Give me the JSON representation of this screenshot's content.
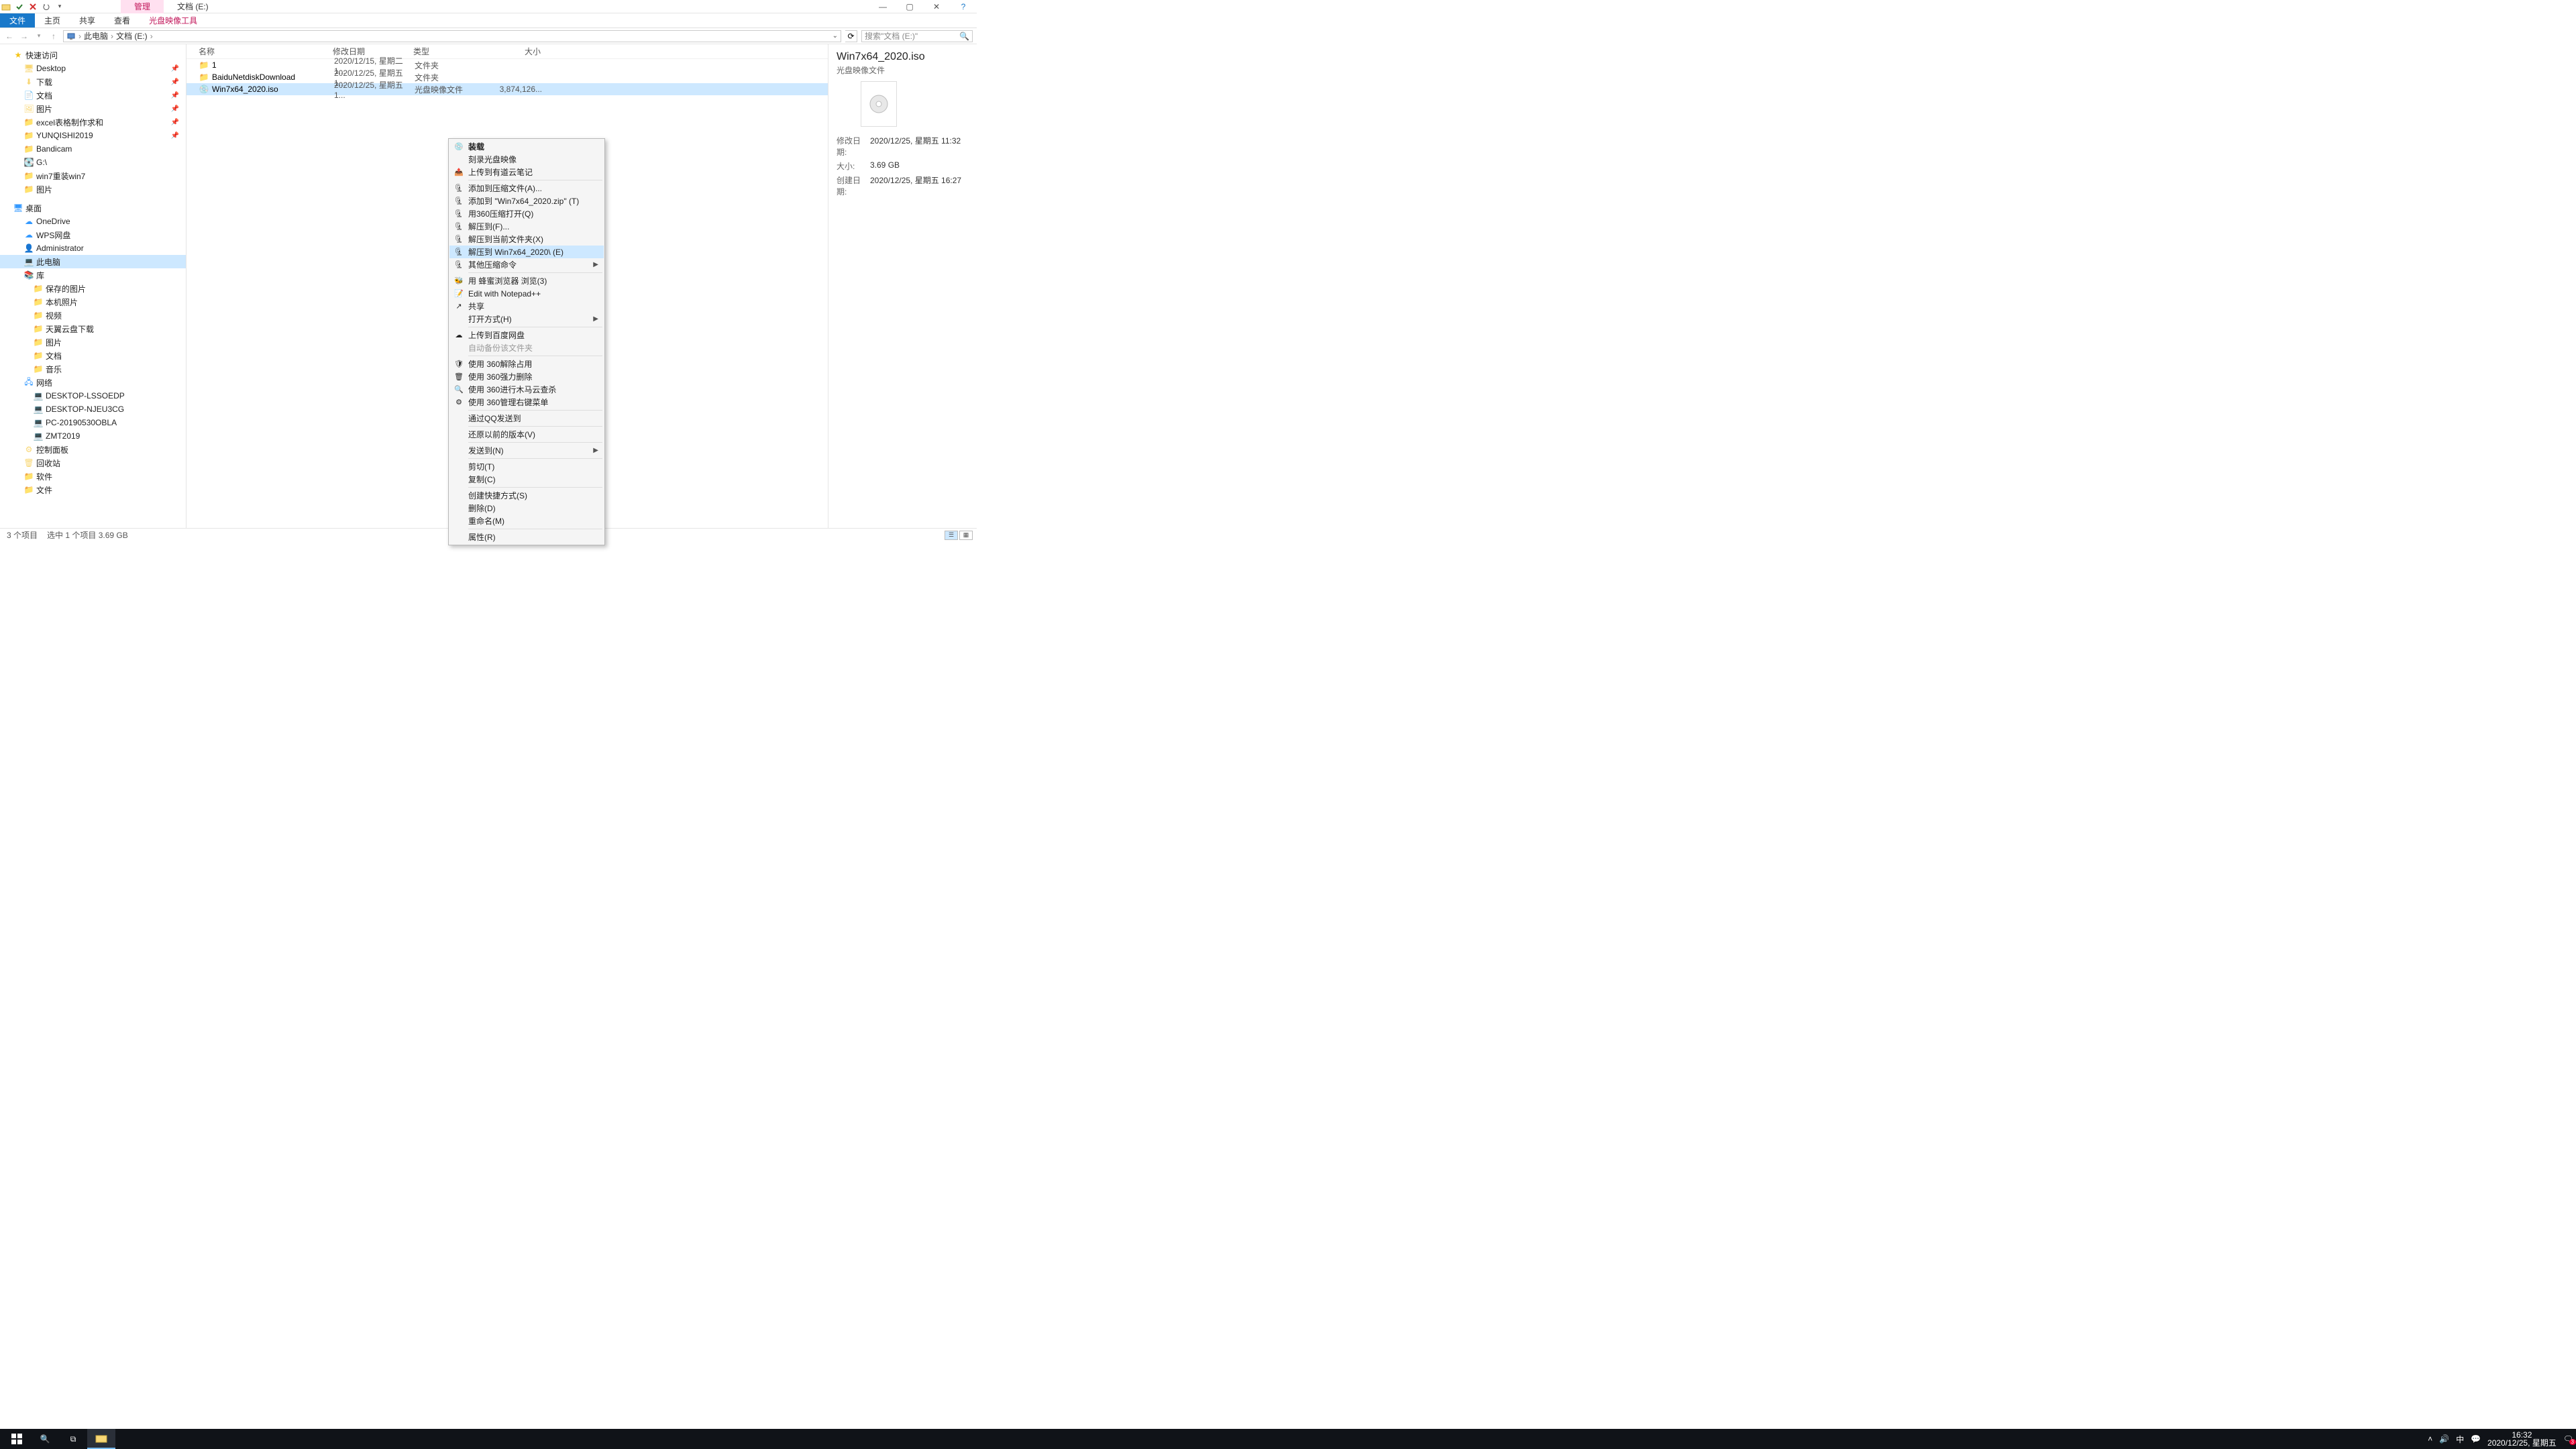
{
  "window": {
    "title_tabs": {
      "manage": "管理",
      "location": "文档 (E:)"
    },
    "sys": {
      "help": "?"
    }
  },
  "ribbon": {
    "file": "文件",
    "home": "主页",
    "share": "共享",
    "view": "查看",
    "disc_tools": "光盘映像工具"
  },
  "nav": {
    "crumbs": [
      "此电脑",
      "文档 (E:)"
    ],
    "search_ph": "搜索\"文档 (E:)\"",
    "refresh_aria": "刷新"
  },
  "tree": {
    "quick": "快速访问",
    "items1": [
      {
        "icon": "desktop",
        "label": "Desktop",
        "pin": true
      },
      {
        "icon": "download",
        "label": "下载",
        "pin": true
      },
      {
        "icon": "docs",
        "label": "文档",
        "pin": true
      },
      {
        "icon": "pics",
        "label": "图片",
        "pin": true
      },
      {
        "icon": "folder",
        "label": "excel表格制作求和",
        "pin": true
      },
      {
        "icon": "folder",
        "label": "YUNQISHI2019",
        "pin": true
      },
      {
        "icon": "folder",
        "label": "Bandicam"
      },
      {
        "icon": "drive",
        "label": "G:\\"
      },
      {
        "icon": "folder",
        "label": "win7重装win7"
      },
      {
        "icon": "folder",
        "label": "图片"
      }
    ],
    "desktop": "桌面",
    "items2": [
      {
        "icon": "onedrive",
        "label": "OneDrive"
      },
      {
        "icon": "wps",
        "label": "WPS网盘"
      },
      {
        "icon": "user",
        "label": "Administrator"
      },
      {
        "icon": "pc",
        "label": "此电脑",
        "sel": true
      },
      {
        "icon": "lib",
        "label": "库"
      }
    ],
    "items3": [
      {
        "label": "保存的图片"
      },
      {
        "label": "本机照片"
      },
      {
        "label": "视频"
      },
      {
        "label": "天翼云盘下载"
      },
      {
        "label": "图片"
      },
      {
        "label": "文档"
      },
      {
        "label": "音乐"
      }
    ],
    "network": "网络",
    "items4": [
      {
        "label": "DESKTOP-LSSOEDP"
      },
      {
        "label": "DESKTOP-NJEU3CG"
      },
      {
        "label": "PC-20190530OBLA"
      },
      {
        "label": "ZMT2019"
      }
    ],
    "items5": [
      {
        "icon": "cpl",
        "label": "控制面板"
      },
      {
        "icon": "recycle",
        "label": "回收站"
      },
      {
        "icon": "folder",
        "label": "软件"
      },
      {
        "icon": "folder",
        "label": "文件"
      }
    ]
  },
  "columns": {
    "name": "名称",
    "date": "修改日期",
    "type": "类型",
    "size": "大小"
  },
  "rows": [
    {
      "icon": "folder",
      "name": "1",
      "date": "2020/12/15, 星期二 1...",
      "type": "文件夹",
      "size": ""
    },
    {
      "icon": "folder",
      "name": "BaiduNetdiskDownload",
      "date": "2020/12/25, 星期五 1...",
      "type": "文件夹",
      "size": ""
    },
    {
      "icon": "iso",
      "name": "Win7x64_2020.iso",
      "date": "2020/12/25, 星期五 1...",
      "type": "光盘映像文件",
      "size": "3,874,126...",
      "sel": true
    }
  ],
  "details": {
    "title": "Win7x64_2020.iso",
    "subtitle": "光盘映像文件",
    "rows": [
      {
        "label": "修改日期:",
        "value": "2020/12/25, 星期五 11:32"
      },
      {
        "label": "大小:",
        "value": "3.69 GB"
      },
      {
        "label": "创建日期:",
        "value": "2020/12/25, 星期五 16:27"
      }
    ]
  },
  "status": {
    "items": "3 个项目",
    "selected": "选中 1 个项目  3.69 GB"
  },
  "ctx": [
    {
      "t": "item",
      "icon": "disc",
      "label": "装载",
      "bold": true
    },
    {
      "t": "item",
      "label": "刻录光盘映像"
    },
    {
      "t": "item",
      "icon": "youdao",
      "label": "上传到有道云笔记"
    },
    {
      "t": "sep"
    },
    {
      "t": "item",
      "icon": "zip",
      "label": "添加到压缩文件(A)..."
    },
    {
      "t": "item",
      "icon": "zip",
      "label": "添加到 \"Win7x64_2020.zip\" (T)"
    },
    {
      "t": "item",
      "icon": "zip",
      "label": "用360压缩打开(Q)"
    },
    {
      "t": "item",
      "icon": "zip",
      "label": "解压到(F)..."
    },
    {
      "t": "item",
      "icon": "zip",
      "label": "解压到当前文件夹(X)"
    },
    {
      "t": "item",
      "icon": "zip",
      "label": "解压到 Win7x64_2020\\ (E)",
      "hl": true
    },
    {
      "t": "item",
      "icon": "zip",
      "label": "其他压缩命令",
      "arrow": true
    },
    {
      "t": "sep"
    },
    {
      "t": "item",
      "icon": "bee",
      "label": "用 蜂蜜浏览器 浏览(3)"
    },
    {
      "t": "item",
      "icon": "npp",
      "label": "Edit with Notepad++"
    },
    {
      "t": "item",
      "icon": "share",
      "label": "共享"
    },
    {
      "t": "item",
      "label": "打开方式(H)",
      "arrow": true
    },
    {
      "t": "sep"
    },
    {
      "t": "item",
      "icon": "baidu",
      "label": "上传到百度网盘"
    },
    {
      "t": "item",
      "label": "自动备份该文件夹",
      "disabled": true
    },
    {
      "t": "sep"
    },
    {
      "t": "item",
      "icon": "s360",
      "label": "使用 360解除占用"
    },
    {
      "t": "item",
      "icon": "s360d",
      "label": "使用 360强力删除"
    },
    {
      "t": "item",
      "icon": "s360s",
      "label": "使用 360进行木马云查杀"
    },
    {
      "t": "item",
      "icon": "s360m",
      "label": "使用 360管理右键菜单"
    },
    {
      "t": "sep"
    },
    {
      "t": "item",
      "label": "通过QQ发送到"
    },
    {
      "t": "sep"
    },
    {
      "t": "item",
      "label": "还原以前的版本(V)"
    },
    {
      "t": "sep"
    },
    {
      "t": "item",
      "label": "发送到(N)",
      "arrow": true
    },
    {
      "t": "sep"
    },
    {
      "t": "item",
      "label": "剪切(T)"
    },
    {
      "t": "item",
      "label": "复制(C)"
    },
    {
      "t": "sep"
    },
    {
      "t": "item",
      "label": "创建快捷方式(S)"
    },
    {
      "t": "item",
      "label": "删除(D)"
    },
    {
      "t": "item",
      "label": "重命名(M)"
    },
    {
      "t": "sep"
    },
    {
      "t": "item",
      "label": "属性(R)"
    }
  ],
  "taskbar": {
    "time": "16:32",
    "date": "2020/12/25, 星期五",
    "ime": "中",
    "badge": "3"
  }
}
